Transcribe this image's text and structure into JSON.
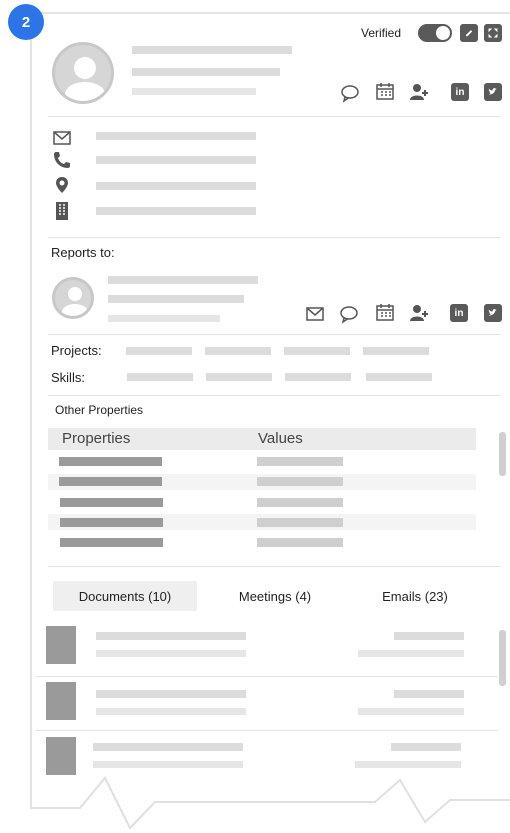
{
  "badge": "2",
  "header": {
    "verified_label": "Verified",
    "verified_on": true,
    "icons": [
      "chat-icon",
      "calendar-icon",
      "add-user-icon",
      "linkedin-icon",
      "twitter-icon"
    ],
    "actions": [
      "edit-icon",
      "expand-icon"
    ]
  },
  "contact": {
    "icons": [
      "email-icon",
      "phone-icon",
      "location-icon",
      "building-icon"
    ]
  },
  "reports_to": {
    "label": "Reports to:",
    "icons": [
      "email-icon",
      "chat-icon",
      "calendar-icon",
      "add-user-icon",
      "linkedin-icon",
      "twitter-icon"
    ]
  },
  "projects_label": "Projects:",
  "skills_label": "Skills:",
  "other_properties": {
    "title": "Other Properties",
    "columns": [
      "Properties",
      "Values"
    ]
  },
  "tabs": [
    {
      "label": "Documents (10)",
      "active": true
    },
    {
      "label": "Meetings (4)",
      "active": false
    },
    {
      "label": "Emails (23)",
      "active": false
    }
  ],
  "colors": {
    "badge": "#2c74e8",
    "toggle": "#5a5a5a",
    "placeholder": "#dcdcdc"
  }
}
